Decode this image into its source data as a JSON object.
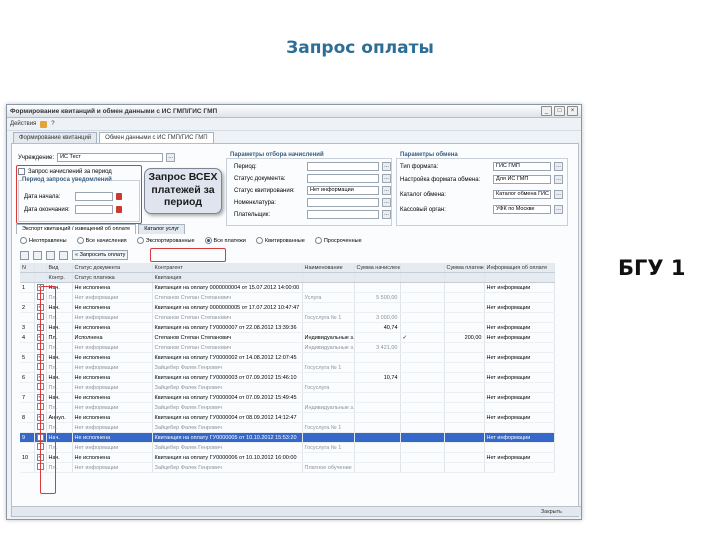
{
  "slide": {
    "title": "Запрос оплаты",
    "side_label": "БГУ 1"
  },
  "window": {
    "title": "Формирование квитанций и обмен данными с ИС ГМП/ГИС ГМП",
    "controls": [
      "_",
      "□",
      "×"
    ],
    "toolbar": {
      "actions_label": "Действия",
      "refresh_label": "⟳",
      "help_label": "?"
    },
    "tabs": [
      "Формирование квитанций",
      "Обмен данными с ИС ГМП/ГИС ГМП"
    ]
  },
  "left_panel": {
    "org_label": "Учреждение:",
    "org_value": "ИС Тест",
    "request_line": "Запрос начислений за период",
    "period_label": "Период запроса уведомлений",
    "date_from_label": "Дата начала:",
    "date_to_label": "Дата окончания:"
  },
  "callout": {
    "text": "Запрос ВСЕХ платежей за период"
  },
  "filter": {
    "title": "Параметры отбора начислений",
    "fields": [
      {
        "label": "Период:",
        "value": ""
      },
      {
        "label": "Статус документа:",
        "value": ""
      },
      {
        "label": "Статус квитирования:",
        "value": "Нет информации"
      },
      {
        "label": "Номенклатура:",
        "value": ""
      },
      {
        "label": "Плательщик:",
        "value": ""
      }
    ]
  },
  "exchange": {
    "title": "Параметры обмена",
    "fields": [
      {
        "label": "Тип формата:",
        "value": "ГИС ГМП"
      },
      {
        "label": "Настройка формата обмена:",
        "value": "Для ИС ГМП"
      },
      {
        "label": "Каталог обмена:",
        "value": "Каталог обмена ГИС"
      },
      {
        "label": "Кассовый орган:",
        "value": "УФК по Москве"
      }
    ]
  },
  "subtabs": [
    "Экспорт квитанций / извещений об оплате",
    "Каталог услуг"
  ],
  "radios": [
    {
      "label": "Неотправлены",
      "on": false
    },
    {
      "label": "Все начисления",
      "on": false
    },
    {
      "label": "Экспортированные",
      "on": false
    },
    {
      "label": "Все платежи",
      "on": true
    },
    {
      "label": "Квитированные",
      "on": false
    },
    {
      "label": "Просроченные",
      "on": false
    }
  ],
  "grid_toolbar": {
    "request_button": "Запросить оплату"
  },
  "table": {
    "headers": [
      "N",
      "",
      "Вид",
      "Статус документа",
      "Контрагент",
      "Наименование",
      "Сумма начисления",
      "",
      "Сумма платежей",
      "Информация об оплате"
    ],
    "headers2": [
      "",
      "",
      "Контр.",
      "Статус платежа",
      "Квитанция",
      "",
      "",
      "",
      "",
      ""
    ],
    "rows": [
      {
        "n": "1",
        "chk": "✓",
        "vid": "Нач.",
        "status": "Не исполнена",
        "kontr": "Квитанция на оплату 0000000004 от 15.07.2012 14:00:00",
        "name": "",
        "sum": "",
        "v": "",
        "pay": "",
        "info": "Нет информации",
        "cls": ""
      },
      {
        "n": "",
        "chk": "",
        "vid": "Пл.",
        "status": "Нет информации",
        "kontr": "Степанов Степан Степанович",
        "name": "Услуга",
        "sum": "5 500,00",
        "v": "",
        "pay": "",
        "info": "",
        "cls": "alt"
      },
      {
        "n": "2",
        "chk": "✓",
        "vid": "Нач.",
        "status": "Не исполнена",
        "kontr": "Квитанция на оплату 0000000005 от 17.07.2012 10:47:47",
        "name": "",
        "sum": "",
        "v": "",
        "pay": "",
        "info": "Нет информации",
        "cls": ""
      },
      {
        "n": "",
        "chk": "",
        "vid": "Пл.",
        "status": "Нет информации",
        "kontr": "Степанов Степан Степанович",
        "name": "Госуслуга № 1",
        "sum": "3 000,00",
        "v": "",
        "pay": "",
        "info": "",
        "cls": "alt"
      },
      {
        "n": "3",
        "chk": "✓",
        "vid": "Нач.",
        "status": "Не исполнена",
        "kontr": "Квитанция на оплату ГУ0000007 от 22.08.2012 13:39:36",
        "name": "",
        "sum": "40,74",
        "v": "",
        "pay": "",
        "info": "Нет информации",
        "cls": ""
      },
      {
        "n": "4",
        "chk": "✓",
        "vid": "Пл.",
        "status": "Исполнена",
        "kontr": "Степанов Степан Степанович",
        "name": "Индивидуальные з...",
        "sum": "",
        "v": "✓",
        "pay": "200,00",
        "info": "Нет информации",
        "cls": ""
      },
      {
        "n": "",
        "chk": "",
        "vid": "Пл.",
        "status": "Нет информации",
        "kontr": "Степанов Степан Степанович",
        "name": "Индивидуальные з...",
        "sum": "3 421,00",
        "v": "",
        "pay": "",
        "info": "",
        "cls": "alt"
      },
      {
        "n": "5",
        "chk": "✓",
        "vid": "Нач.",
        "status": "Не исполнена",
        "kontr": "Квитанция на оплату ГУ0000002 от 14.08.2012 12:07:45",
        "name": "",
        "sum": "",
        "v": "",
        "pay": "",
        "info": "Нет информации",
        "cls": ""
      },
      {
        "n": "",
        "chk": "",
        "vid": "Пл.",
        "status": "Нет информации",
        "kontr": "Зайцебер Фалек Генрович",
        "name": "Госуслуга № 1",
        "sum": "",
        "v": "",
        "pay": "",
        "info": "",
        "cls": "alt"
      },
      {
        "n": "6",
        "chk": "✓",
        "vid": "Нач.",
        "status": "Не исполнена",
        "kontr": "Квитанция на оплату ГУ0000003 от 07.09.2012 15:46:10",
        "name": "",
        "sum": "10,74",
        "v": "",
        "pay": "",
        "info": "Нет информации",
        "cls": ""
      },
      {
        "n": "",
        "chk": "",
        "vid": "Пл.",
        "status": "Нет информации",
        "kontr": "Зайцебер Фалек Генрович",
        "name": "Госуслуга",
        "sum": "",
        "v": "",
        "pay": "",
        "info": "",
        "cls": "alt"
      },
      {
        "n": "7",
        "chk": "✓",
        "vid": "Нач.",
        "status": "Не исполнена",
        "kontr": "Квитанция на оплату ГУ0000004 от 07.09.2012 15:49:45",
        "name": "",
        "sum": "",
        "v": "",
        "pay": "",
        "info": "Нет информации",
        "cls": ""
      },
      {
        "n": "",
        "chk": "",
        "vid": "Пл.",
        "status": "Нет информации",
        "kontr": "Зайцебер Фалек Генрович",
        "name": "Индивидуальные з...",
        "sum": "",
        "v": "",
        "pay": "",
        "info": "",
        "cls": "alt"
      },
      {
        "n": "8",
        "chk": "✓",
        "vid": "Аннул.",
        "status": "Не исполнена",
        "kontr": "Квитанция на оплату ГУ0000004 от 08.09.2012 14:12:47",
        "name": "",
        "sum": "",
        "v": "",
        "pay": "",
        "info": "Нет информации",
        "cls": ""
      },
      {
        "n": "",
        "chk": "",
        "vid": "Пл.",
        "status": "Нет информации",
        "kontr": "Зайцебер Фалек Генрович",
        "name": "Госуслуга № 1",
        "sum": "",
        "v": "",
        "pay": "",
        "info": "",
        "cls": "alt"
      },
      {
        "n": "9",
        "chk": "✓",
        "vid": "Нач.",
        "status": "Не исполнена",
        "kontr": "Квитанция на оплату ГУ0000005 от 10.10.2012 15:53:20",
        "name": "",
        "sum": "",
        "v": "",
        "pay": "",
        "info": "Нет информации",
        "cls": "sel"
      },
      {
        "n": "",
        "chk": "",
        "vid": "Пл.",
        "status": "Нет информации",
        "kontr": "Зайцебер Фалек Генрович",
        "name": "Госуслуга № 1",
        "sum": "",
        "v": "",
        "pay": "",
        "info": "",
        "cls": "alt"
      },
      {
        "n": "10",
        "chk": "✓",
        "vid": "Нач.",
        "status": "Не исполнена",
        "kontr": "Квитанция на оплату ГУ0000006 от 10.10.2012 16:00:00",
        "name": "",
        "sum": "",
        "v": "",
        "pay": "",
        "info": "Нет информации",
        "cls": ""
      },
      {
        "n": "",
        "chk": "",
        "vid": "Пл.",
        "status": "Нет информации",
        "kontr": "Зайцебер Фалек Генрович",
        "name": "Платное обучение",
        "sum": "",
        "v": "",
        "pay": "",
        "info": "",
        "cls": "alt"
      }
    ]
  },
  "statusbar": {
    "close_label": "Закрыть"
  },
  "colors": {
    "accent": "#2e6e96",
    "highlight": "#d63a3a",
    "selection": "#3668c9"
  }
}
